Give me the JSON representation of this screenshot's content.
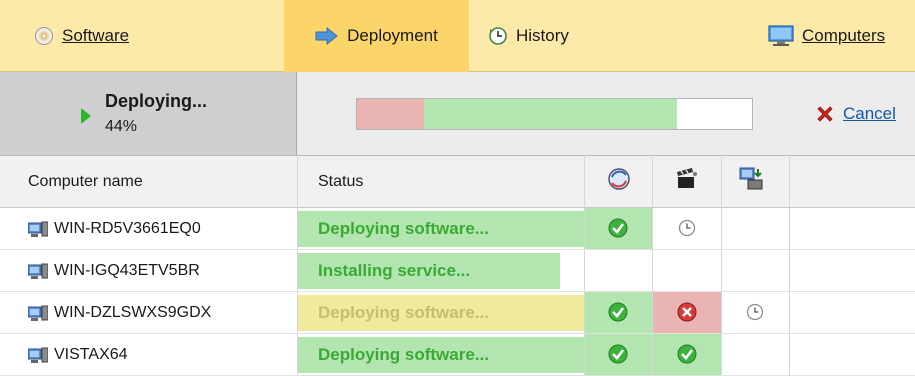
{
  "nav": {
    "software": {
      "label": "Software",
      "icon": "cd-icon"
    },
    "deployment": {
      "label": "Deployment",
      "icon": "arrow-right-icon"
    },
    "history": {
      "label": "History",
      "icon": "history-clock-icon"
    },
    "computers": {
      "label": "Computers",
      "icon": "monitor-icon"
    }
  },
  "deploy_status": {
    "title": "Deploying...",
    "percent_text": "44%",
    "progress": {
      "failed_fraction": 0.17,
      "succeeded_fraction": 0.64
    },
    "cancel_label": "Cancel"
  },
  "table": {
    "columns": {
      "computer_name": "Computer name",
      "status": "Status",
      "icon1": "globe-refresh-icon",
      "icon2": "clapper-icon",
      "icon3": "computer-install-icon"
    },
    "rows": [
      {
        "name": "WIN-RD5V3661EQ0",
        "status": "Deploying software...",
        "status_style": "green",
        "c1": "check",
        "c2": "pending",
        "c3": ""
      },
      {
        "name": "WIN-IGQ43ETV5BR",
        "status": "Installing service...",
        "status_style": "green",
        "c1": "",
        "c2": "",
        "c3": ""
      },
      {
        "name": "WIN-DZLSWXS9GDX",
        "status": "Deploying software...",
        "status_style": "yellow",
        "c1": "check",
        "c2": "error",
        "c3": "pending"
      },
      {
        "name": "VISTAX64",
        "status": "Deploying software...",
        "status_style": "green",
        "c1": "check",
        "c2": "check",
        "c3": ""
      }
    ]
  },
  "colors": {
    "check_bg": "#b3e5b0",
    "error_bg": "#e9b4b1",
    "accent_tab": "#fbd56a",
    "topbar": "#fde9a8"
  }
}
